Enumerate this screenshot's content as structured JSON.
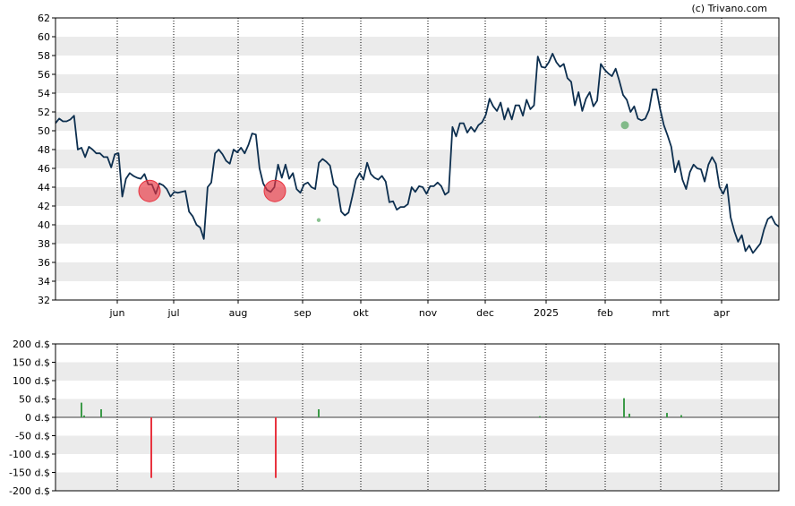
{
  "copyright": "(c) Trivano.com",
  "chart_data": [
    {
      "type": "line",
      "title": "",
      "y_ticks": [
        "62",
        "60",
        "58",
        "56",
        "54",
        "52",
        "50",
        "48",
        "46",
        "44",
        "42",
        "40",
        "38",
        "36",
        "34",
        "32"
      ],
      "ylim": [
        32,
        62
      ],
      "x_ticks": [
        "jun",
        "jul",
        "aug",
        "sep",
        "okt",
        "nov",
        "dec",
        "2025",
        "feb",
        "mrt",
        "apr"
      ],
      "grid": "horizontal bands + vertical dotted lines at month ticks",
      "colors": {
        "line": "#0d2f4f",
        "sell_marker": "#e8333f",
        "buy_marker": "#3c9a48",
        "band": "#ebebeb"
      },
      "series": [
        {
          "values": [
            50.8,
            51.3,
            51.0,
            51.0,
            51.2,
            51.6,
            48.0,
            48.2,
            47.2,
            48.3,
            48.0,
            47.6,
            47.6,
            47.2,
            47.2,
            46.1,
            47.5,
            47.6,
            43.0,
            44.9,
            45.5,
            45.2,
            45.0,
            44.9,
            45.4,
            44.3,
            44.3,
            43.3,
            44.4,
            44.2,
            43.8,
            43.0,
            43.5,
            43.4,
            43.5,
            43.6,
            41.4,
            40.9,
            40.0,
            39.7,
            38.5,
            44.0,
            44.5,
            47.6,
            48.0,
            47.5,
            46.8,
            46.5,
            48.0,
            47.7,
            48.2,
            47.6,
            48.5,
            49.7,
            49.6,
            46.0,
            44.4,
            43.7,
            43.5,
            44.0,
            46.4,
            45.0,
            46.4,
            44.9,
            45.5,
            43.8,
            43.4,
            44.3,
            44.5,
            44.0,
            43.8,
            46.6,
            47.0,
            46.7,
            46.3,
            44.3,
            43.9,
            41.4,
            41.0,
            41.3,
            43.0,
            44.8,
            45.5,
            44.8,
            46.6,
            45.4,
            45.0,
            44.8,
            45.2,
            44.6,
            42.4,
            42.5,
            41.6,
            41.9,
            41.9,
            42.2,
            44.0,
            43.5,
            44.1,
            44.0,
            43.3,
            44.1,
            44.1,
            44.5,
            44.1,
            43.2,
            43.5,
            50.4,
            49.4,
            50.8,
            50.8,
            49.8,
            50.4,
            49.9,
            50.6,
            50.9,
            51.7,
            53.4,
            52.6,
            52.1,
            53.0,
            51.2,
            52.4,
            51.2,
            52.7,
            52.7,
            51.6,
            53.3,
            52.3,
            52.7,
            57.9,
            56.8,
            56.7,
            57.3,
            58.2,
            57.3,
            56.8,
            57.1,
            55.6,
            55.2,
            52.7,
            54.1,
            52.1,
            53.4,
            54.1,
            52.6,
            53.2,
            57.1,
            56.5,
            56.1,
            55.8,
            56.6,
            55.3,
            53.8,
            53.3,
            52.0,
            52.6,
            51.3,
            51.1,
            51.3,
            52.2,
            54.4,
            54.4,
            52.3,
            50.6,
            49.5,
            48.3,
            45.6,
            46.8,
            44.8,
            43.8,
            45.6,
            46.4,
            46.0,
            45.9,
            44.6,
            46.4,
            47.2,
            46.5,
            44.0,
            43.3,
            44.3,
            40.8,
            39.3,
            38.2,
            38.9,
            37.2,
            37.8,
            37.0,
            37.5,
            38.0,
            39.5,
            40.6,
            40.9,
            40.1,
            39.8
          ]
        }
      ],
      "markers": [
        {
          "kind": "sell",
          "date_label": "jun",
          "value": 43.6
        },
        {
          "kind": "sell",
          "date_label": "aug",
          "value": 43.6
        },
        {
          "kind": "buy",
          "date_label": "sep",
          "value": 40.5
        },
        {
          "kind": "buy",
          "date_label": "feb",
          "value": 50.6
        }
      ]
    },
    {
      "type": "bar",
      "title": "",
      "y_ticks": [
        "200 d.$",
        "150 d.$",
        "100 d.$",
        "50 d.$",
        "0 d.$",
        "-50 d.$",
        "-100 d.$",
        "-150 d.$",
        "-200 d.$"
      ],
      "ylim": [
        -200,
        200
      ],
      "colors": {
        "positive": "#3c9a48",
        "negative": "#e8333f"
      },
      "bars": [
        {
          "month": "mei",
          "value": 40
        },
        {
          "month": "mei",
          "value": 5
        },
        {
          "month": "mei",
          "value": 22
        },
        {
          "month": "jun",
          "value": -165
        },
        {
          "month": "aug",
          "value": -165
        },
        {
          "month": "sep",
          "value": 22
        },
        {
          "month": "jan",
          "value": 3
        },
        {
          "month": "feb",
          "value": 52
        },
        {
          "month": "feb",
          "value": 10
        },
        {
          "month": "mrt",
          "value": 12
        },
        {
          "month": "mrt",
          "value": 6
        }
      ]
    }
  ]
}
